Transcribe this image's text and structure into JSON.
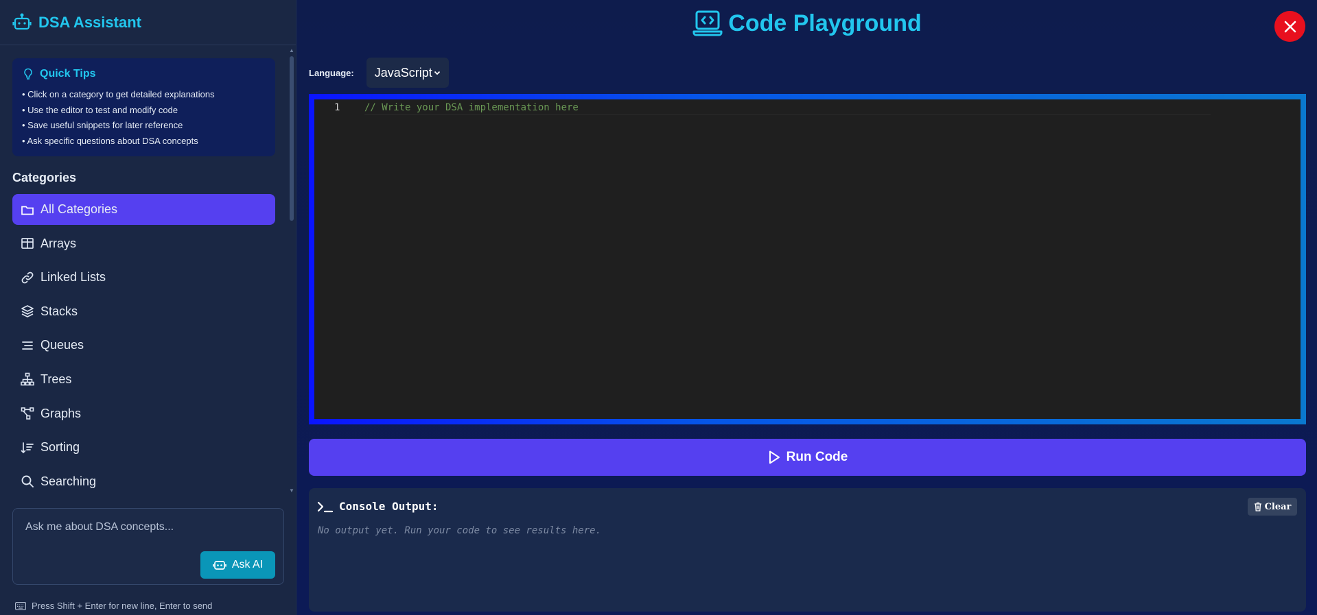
{
  "sidebar": {
    "brand": {
      "title": "DSA Assistant",
      "icon": "robot-icon"
    },
    "tips": {
      "title": "Quick Tips",
      "icon": "lightbulb-icon",
      "items": [
        "• Click on a category to get detailed explanations",
        "• Use the editor to test and modify code",
        "• Save useful snippets for later reference",
        "• Ask specific questions about DSA concepts"
      ]
    },
    "categories_label": "Categories",
    "categories": [
      {
        "label": "All Categories",
        "icon": "folder-icon",
        "active": true
      },
      {
        "label": "Arrays",
        "icon": "table-icon",
        "active": false
      },
      {
        "label": "Linked Lists",
        "icon": "link-icon",
        "active": false
      },
      {
        "label": "Stacks",
        "icon": "layers-icon",
        "active": false
      },
      {
        "label": "Queues",
        "icon": "queue-icon",
        "active": false
      },
      {
        "label": "Trees",
        "icon": "tree-icon",
        "active": false
      },
      {
        "label": "Graphs",
        "icon": "graph-icon",
        "active": false
      },
      {
        "label": "Sorting",
        "icon": "sort-icon",
        "active": false
      },
      {
        "label": "Searching",
        "icon": "search-icon",
        "active": false
      }
    ],
    "ask": {
      "placeholder": "Ask me about DSA concepts...",
      "button_label": "Ask AI",
      "button_icon": "robot-icon"
    },
    "hint": "Press Shift + Enter for new line, Enter to send"
  },
  "main": {
    "title": "Code Playground",
    "title_icon": "laptop-code-icon",
    "close_icon": "close-icon",
    "language": {
      "label": "Language:",
      "selected": "JavaScript"
    },
    "editor": {
      "lines": [
        {
          "number": "1",
          "text": "// Write your DSA implementation here"
        }
      ]
    },
    "run_label": "Run Code",
    "console": {
      "title": "Console Output:",
      "clear_label": "Clear",
      "output": "No output yet. Run your code to see results here."
    }
  },
  "colors": {
    "accent": "#22c6ee",
    "primary": "#5540f0",
    "close": "#e8101e",
    "sidebar_bg": "#1a2744",
    "main_bg": "#0d1b4a"
  }
}
